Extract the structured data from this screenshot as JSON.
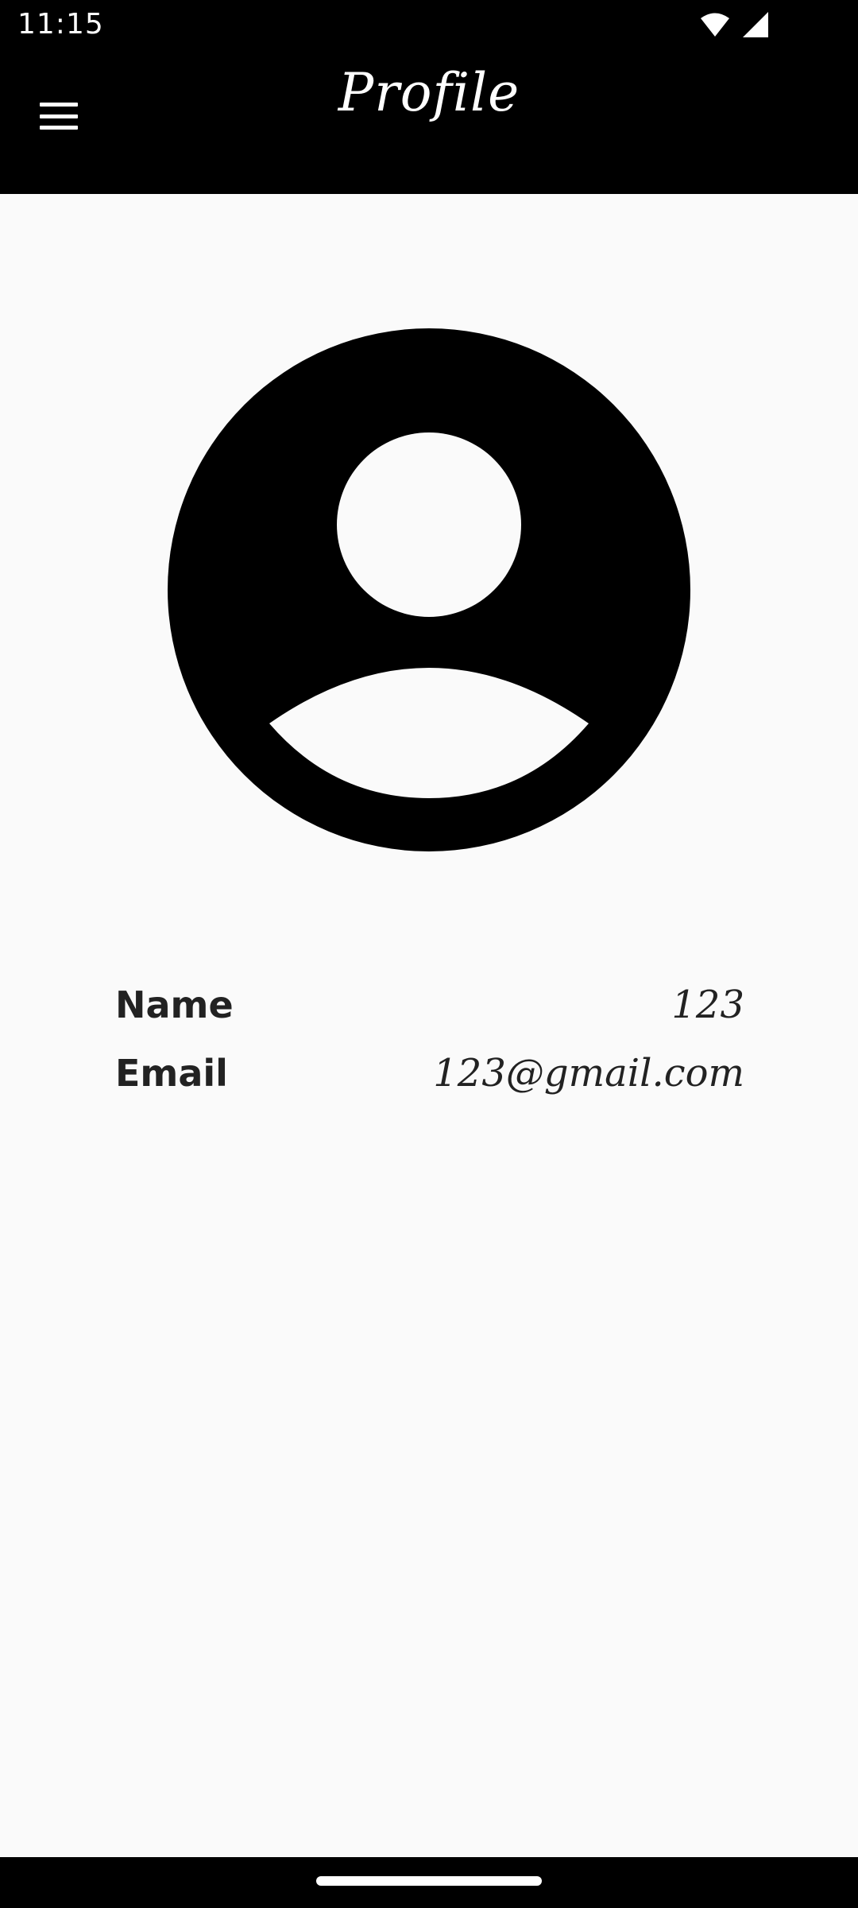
{
  "status_bar": {
    "time": "11:15",
    "icons": [
      "wifi-icon",
      "cellular-signal-icon"
    ]
  },
  "app_bar": {
    "title": "Profile",
    "menu_icon": "hamburger-menu-icon"
  },
  "avatar": {
    "icon": "account-circle-icon"
  },
  "profile": {
    "name_label": "Name",
    "name_value": "123",
    "email_label": "Email",
    "email_value": "123@gmail.com"
  },
  "colors": {
    "app_bar": "#000000",
    "background": "#fafafa",
    "text": "#222222"
  }
}
